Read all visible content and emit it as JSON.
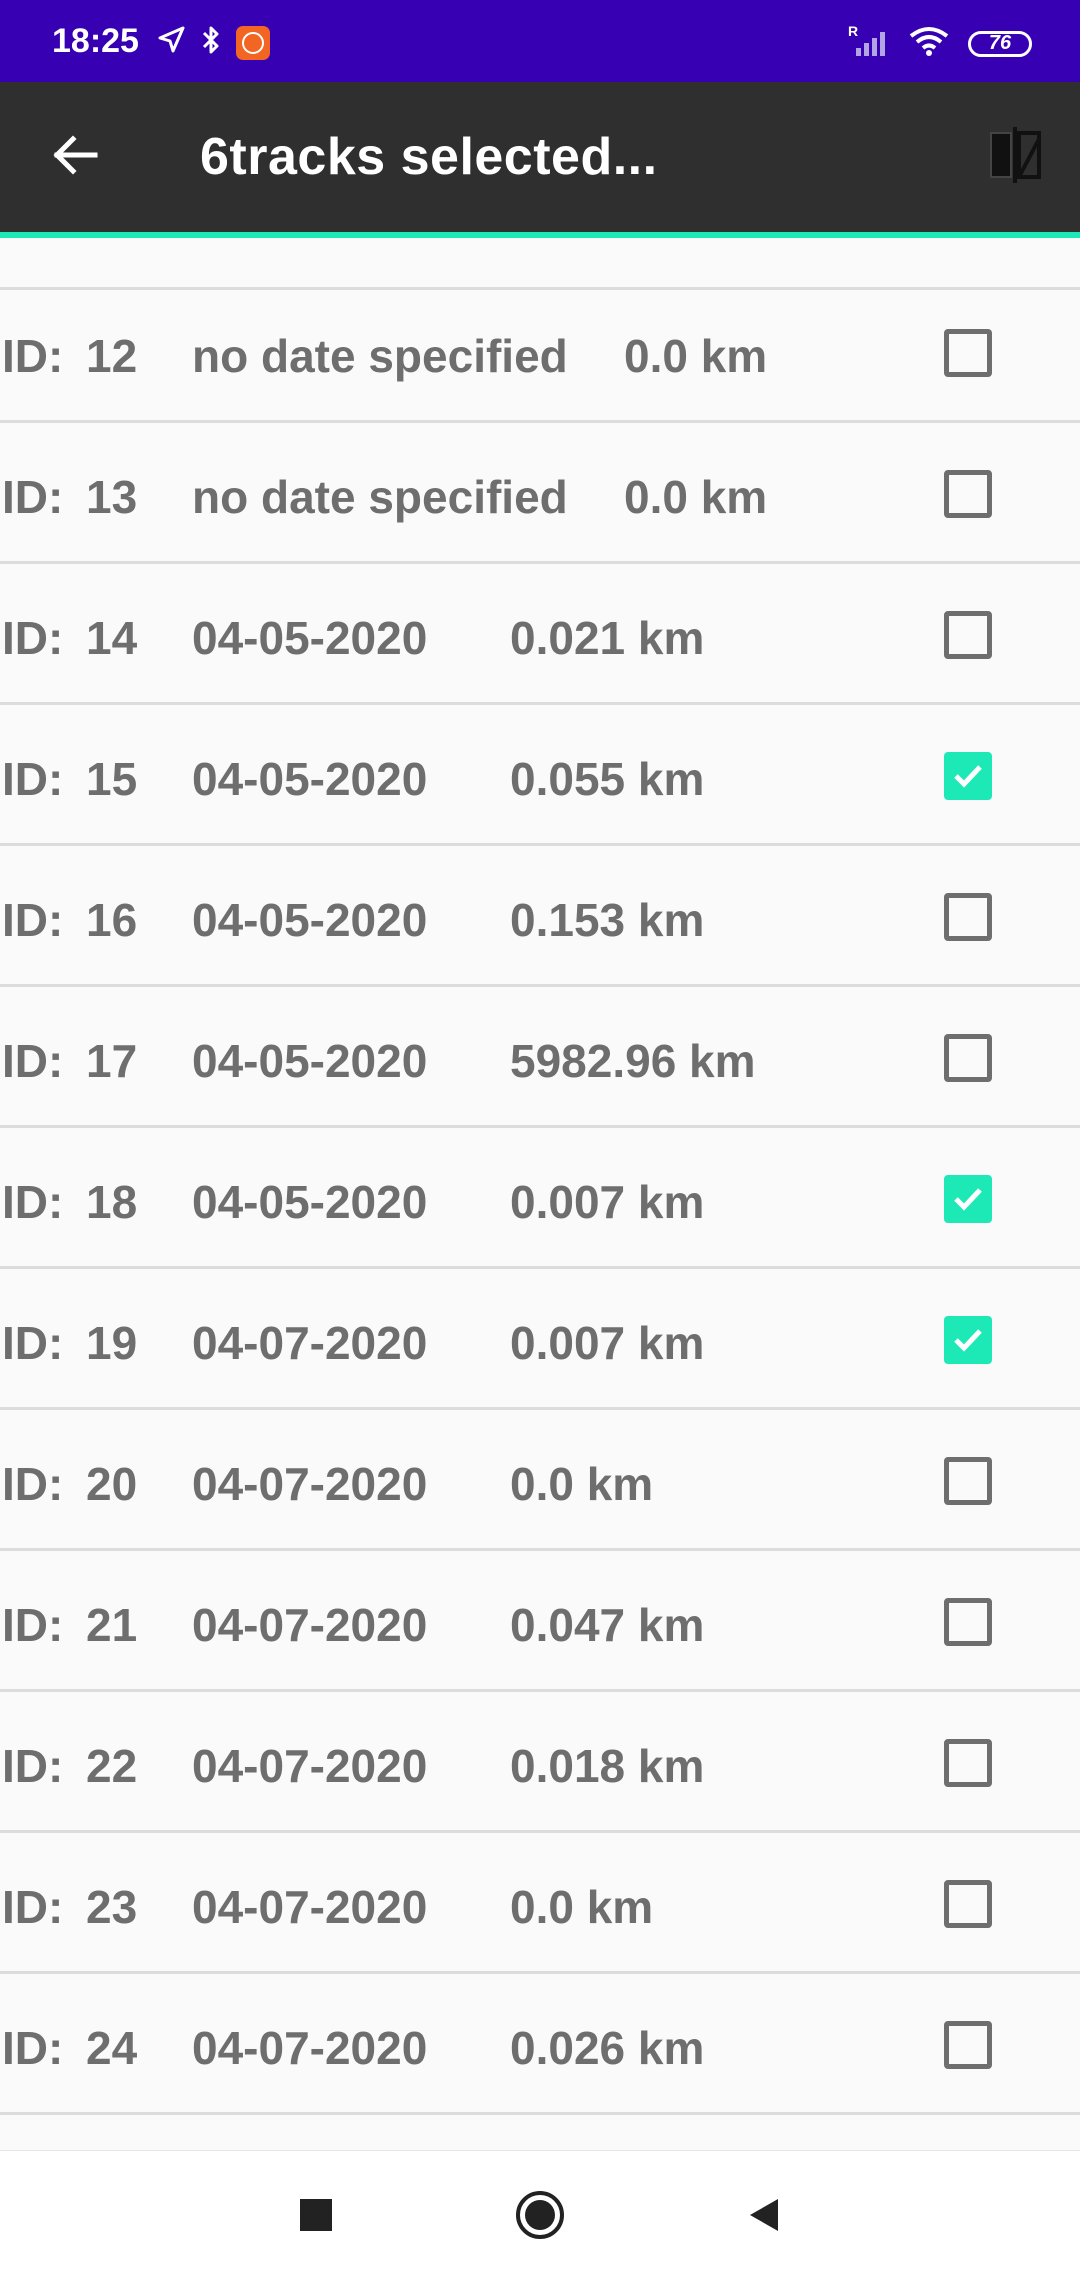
{
  "status_bar": {
    "time": "18:25",
    "battery": "76",
    "icons": [
      "location-arrow-icon",
      "bluetooth-icon",
      "app-notification-icon",
      "signal-icon",
      "wifi-icon",
      "battery-icon"
    ]
  },
  "app_bar": {
    "title": "6tracks selected...",
    "back_icon": "arrow-left-icon",
    "action_icon": "compare-icon"
  },
  "tracks": [
    {
      "id_label": "ID:",
      "id": "12",
      "date": "no date specified",
      "distance": "0.0 km",
      "checked": false
    },
    {
      "id_label": "ID:",
      "id": "13",
      "date": "no date specified",
      "distance": "0.0 km",
      "checked": false
    },
    {
      "id_label": "ID:",
      "id": "14",
      "date": "04-05-2020",
      "distance": "0.021 km",
      "checked": false
    },
    {
      "id_label": "ID:",
      "id": "15",
      "date": "04-05-2020",
      "distance": "0.055 km",
      "checked": true
    },
    {
      "id_label": "ID:",
      "id": "16",
      "date": "04-05-2020",
      "distance": "0.153 km",
      "checked": false
    },
    {
      "id_label": "ID:",
      "id": "17",
      "date": "04-05-2020",
      "distance": "5982.96 km",
      "checked": false
    },
    {
      "id_label": "ID:",
      "id": "18",
      "date": "04-05-2020",
      "distance": "0.007 km",
      "checked": true
    },
    {
      "id_label": "ID:",
      "id": "19",
      "date": "04-07-2020",
      "distance": "0.007 km",
      "checked": true
    },
    {
      "id_label": "ID:",
      "id": "20",
      "date": "04-07-2020",
      "distance": "0.0 km",
      "checked": false
    },
    {
      "id_label": "ID:",
      "id": "21",
      "date": "04-07-2020",
      "distance": "0.047 km",
      "checked": false
    },
    {
      "id_label": "ID:",
      "id": "22",
      "date": "04-07-2020",
      "distance": "0.018 km",
      "checked": false
    },
    {
      "id_label": "ID:",
      "id": "23",
      "date": "04-07-2020",
      "distance": "0.0 km",
      "checked": false
    },
    {
      "id_label": "ID:",
      "id": "24",
      "date": "04-07-2020",
      "distance": "0.026 km",
      "checked": false
    }
  ],
  "nav_bar": {
    "buttons": [
      "recent-apps-icon",
      "home-icon",
      "back-triangle-icon"
    ]
  },
  "colors": {
    "status_bar": "#3700b3",
    "app_bar": "#2f2f2f",
    "accent": "#1de9b6",
    "row_text": "#6e6e6e"
  }
}
